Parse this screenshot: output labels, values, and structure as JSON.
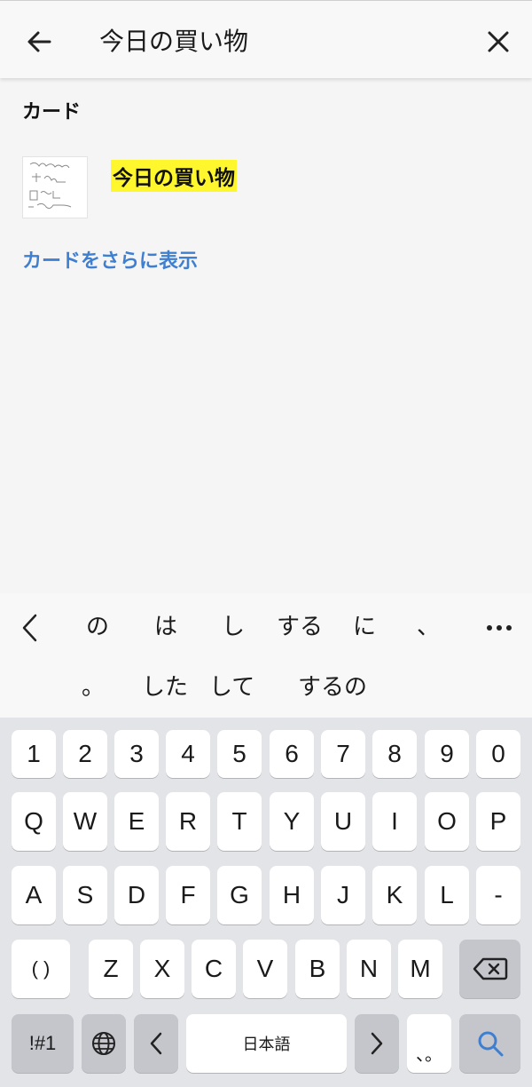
{
  "header": {
    "back_icon": "arrow-left-icon",
    "query": "今日の買い物",
    "clear_icon": "close-icon"
  },
  "results": {
    "section_title": "カード",
    "cards": [
      {
        "title": "今日の買い物",
        "thumbnail": "handwritten-note-thumbnail"
      }
    ],
    "more_label": "カードをさらに表示",
    "highlight_color": "#fff72d",
    "link_color": "#3f7fd0"
  },
  "candidates": {
    "collapse_icon": "chevron-left-icon",
    "row1": [
      "の",
      "は",
      "し",
      "する",
      "に",
      "、"
    ],
    "more_icon": "ellipsis-icon",
    "row2": [
      "。",
      "した",
      "して",
      "するの"
    ]
  },
  "keyboard": {
    "numbers": [
      "1",
      "2",
      "3",
      "4",
      "5",
      "6",
      "7",
      "8",
      "9",
      "0"
    ],
    "row_q": [
      "Q",
      "W",
      "E",
      "R",
      "T",
      "Y",
      "U",
      "I",
      "O",
      "P"
    ],
    "row_a": [
      "A",
      "S",
      "D",
      "F",
      "G",
      "H",
      "J",
      "K",
      "L",
      "-"
    ],
    "row_z_first": "( )",
    "row_z": [
      "Z",
      "X",
      "C",
      "V",
      "B",
      "N",
      "M"
    ],
    "backspace_icon": "backspace-icon",
    "symbols_label": "!#1",
    "globe_icon": "globe-icon",
    "left_icon": "chevron-left-icon",
    "space_label": "日本語",
    "right_icon": "chevron-right-icon",
    "punct_label": "、。",
    "search_icon": "search-icon",
    "accent_color": "#3f7fd0"
  }
}
